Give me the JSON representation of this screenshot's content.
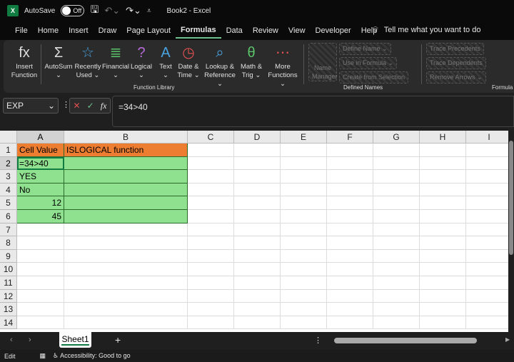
{
  "titlebar": {
    "app_icon": "X",
    "autosave_label": "AutoSave",
    "autosave_state": "Off",
    "title": "Book2  -  Excel"
  },
  "menu_tabs": [
    "File",
    "Home",
    "Insert",
    "Draw",
    "Page Layout",
    "Formulas",
    "Data",
    "Review",
    "View",
    "Developer",
    "Help"
  ],
  "active_tab": "Formulas",
  "tell_me": "Tell me what you want to do",
  "ribbon": {
    "function_library": [
      {
        "icon": "fx",
        "l1": "Insert",
        "l2": "Function"
      },
      {
        "icon": "Σ",
        "l1": "AutoSum",
        "l2": "⌄"
      },
      {
        "icon": "☆",
        "l1": "Recently",
        "l2": "Used ⌄"
      },
      {
        "icon": "≣",
        "l1": "Financial",
        "l2": "⌄"
      },
      {
        "icon": "?",
        "l1": "Logical",
        "l2": "⌄"
      },
      {
        "icon": "A",
        "l1": "Text",
        "l2": "⌄"
      },
      {
        "icon": "◷",
        "l1": "Date &",
        "l2": "Time ⌄"
      },
      {
        "icon": "⌕",
        "l1": "Lookup &",
        "l2": "Reference ⌄"
      },
      {
        "icon": "θ",
        "l1": "Math &",
        "l2": "Trig ⌄"
      },
      {
        "icon": "⋯",
        "l1": "More",
        "l2": "Functions ⌄"
      }
    ],
    "function_library_label": "Function Library",
    "name_manager": [
      "Name",
      "Manager"
    ],
    "defined_names": [
      "Define Name ⌄",
      "Use in Formula ⌄",
      "Create from Selection"
    ],
    "defined_names_label": "Defined Names",
    "auditing": [
      "Trace Precedents",
      "Trace Dependents",
      "Remove Arrows ⌄"
    ],
    "auditing_label": "Formula"
  },
  "formula_bar": {
    "name_box": "EXP",
    "formula": "=34>40"
  },
  "columns": [
    "A",
    "B",
    "C",
    "D",
    "E",
    "F",
    "G",
    "H",
    "I"
  ],
  "rows": [
    "1",
    "2",
    "3",
    "4",
    "5",
    "6",
    "7",
    "8",
    "9",
    "10",
    "11",
    "12",
    "13",
    "14"
  ],
  "cells": {
    "A1": "Cell Value",
    "B1": "ISLOGICAL function",
    "A2": "=34>40",
    "A3": "YES",
    "A4": "No",
    "A5": "12",
    "A6": "45"
  },
  "colors": {
    "header_fill": "#ed7d31",
    "data_fill": "#8fe08f",
    "accent": "#107c41"
  },
  "sheets": [
    "Sheet1"
  ],
  "add_sheet": "+",
  "status": {
    "mode": "Edit",
    "accessibility": "Accessibility: Good to go"
  }
}
